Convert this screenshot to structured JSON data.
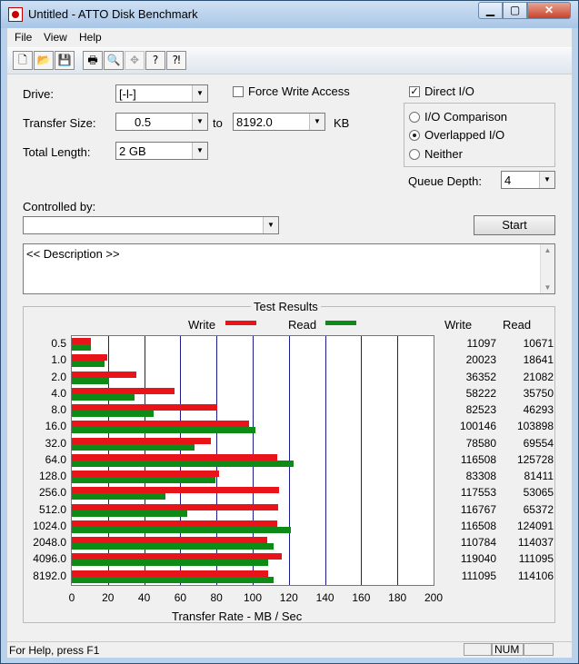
{
  "window": {
    "title": "Untitled - ATTO Disk Benchmark"
  },
  "menu": [
    "File",
    "View",
    "Help"
  ],
  "toolbar": [
    {
      "icon": "new-icon",
      "glyph": "🗋"
    },
    {
      "icon": "open-icon",
      "glyph": "📂"
    },
    {
      "icon": "save-icon",
      "glyph": "💾"
    },
    {
      "icon": "print-icon",
      "glyph": "🖶"
    },
    {
      "icon": "print-preview-icon",
      "glyph": "🔍"
    },
    {
      "icon": "move-icon",
      "glyph": "✥"
    },
    {
      "icon": "help-icon",
      "glyph": "?"
    },
    {
      "icon": "context-help-icon",
      "glyph": "⁈"
    }
  ],
  "form": {
    "drive_label": "Drive:",
    "drive_value": "[-l-]",
    "force_write_label": "Force Write Access",
    "direct_io_label": "Direct I/O",
    "direct_io_checked": "✓",
    "transfer_size_label": "Transfer Size:",
    "transfer_from": "0.5",
    "to_label": "to",
    "transfer_to": "8192.0",
    "unit": "KB",
    "total_length_label": "Total Length:",
    "total_length_value": "2 GB",
    "io_comparison": "I/O Comparison",
    "overlapped_io": "Overlapped I/O",
    "neither": "Neither",
    "queue_depth_label": "Queue Depth:",
    "queue_depth_value": "4",
    "controlled_by_label": "Controlled by:",
    "controlled_by_value": "",
    "start_button": "Start",
    "description": "<< Description >>"
  },
  "results": {
    "title": "Test Results",
    "legend_write": "Write",
    "legend_read": "Read",
    "col_write": "Write",
    "col_read": "Read",
    "xlabel": "Transfer Rate - MB / Sec",
    "write_color": "#e8141a",
    "read_color": "#0e8a16"
  },
  "chart_data": {
    "type": "bar",
    "orientation": "horizontal",
    "title": "Test Results",
    "xlabel": "Transfer Rate - MB / Sec",
    "xlim": [
      0,
      200
    ],
    "xticks": [
      "0",
      "20",
      "40",
      "60",
      "80",
      "100",
      "120",
      "140",
      "160",
      "180",
      "200"
    ],
    "categories": [
      "0.5",
      "1.0",
      "2.0",
      "4.0",
      "8.0",
      "16.0",
      "32.0",
      "64.0",
      "128.0",
      "256.0",
      "512.0",
      "1024.0",
      "2048.0",
      "4096.0",
      "8192.0"
    ],
    "series": [
      {
        "name": "Write",
        "values": [
          10.8,
          19.6,
          35.5,
          56.9,
          80.6,
          97.8,
          76.7,
          113.8,
          81.4,
          114.8,
          114.0,
          113.8,
          108.2,
          116.3,
          108.5
        ],
        "labels": [
          "11097",
          "20023",
          "36352",
          "58222",
          "82523",
          "100146",
          "78580",
          "116508",
          "83308",
          "117553",
          "116767",
          "116508",
          "110784",
          "119040",
          "111095"
        ]
      },
      {
        "name": "Read",
        "values": [
          10.4,
          18.2,
          20.6,
          34.9,
          45.2,
          101.5,
          67.9,
          122.8,
          79.5,
          51.8,
          63.8,
          121.2,
          111.4,
          108.5,
          111.4
        ],
        "labels": [
          "10671",
          "18641",
          "21082",
          "35750",
          "46293",
          "103898",
          "69554",
          "125728",
          "81411",
          "53065",
          "65372",
          "124091",
          "114037",
          "111095",
          "114106"
        ]
      }
    ]
  },
  "status": {
    "help": "For Help, press F1",
    "num": "NUM"
  }
}
